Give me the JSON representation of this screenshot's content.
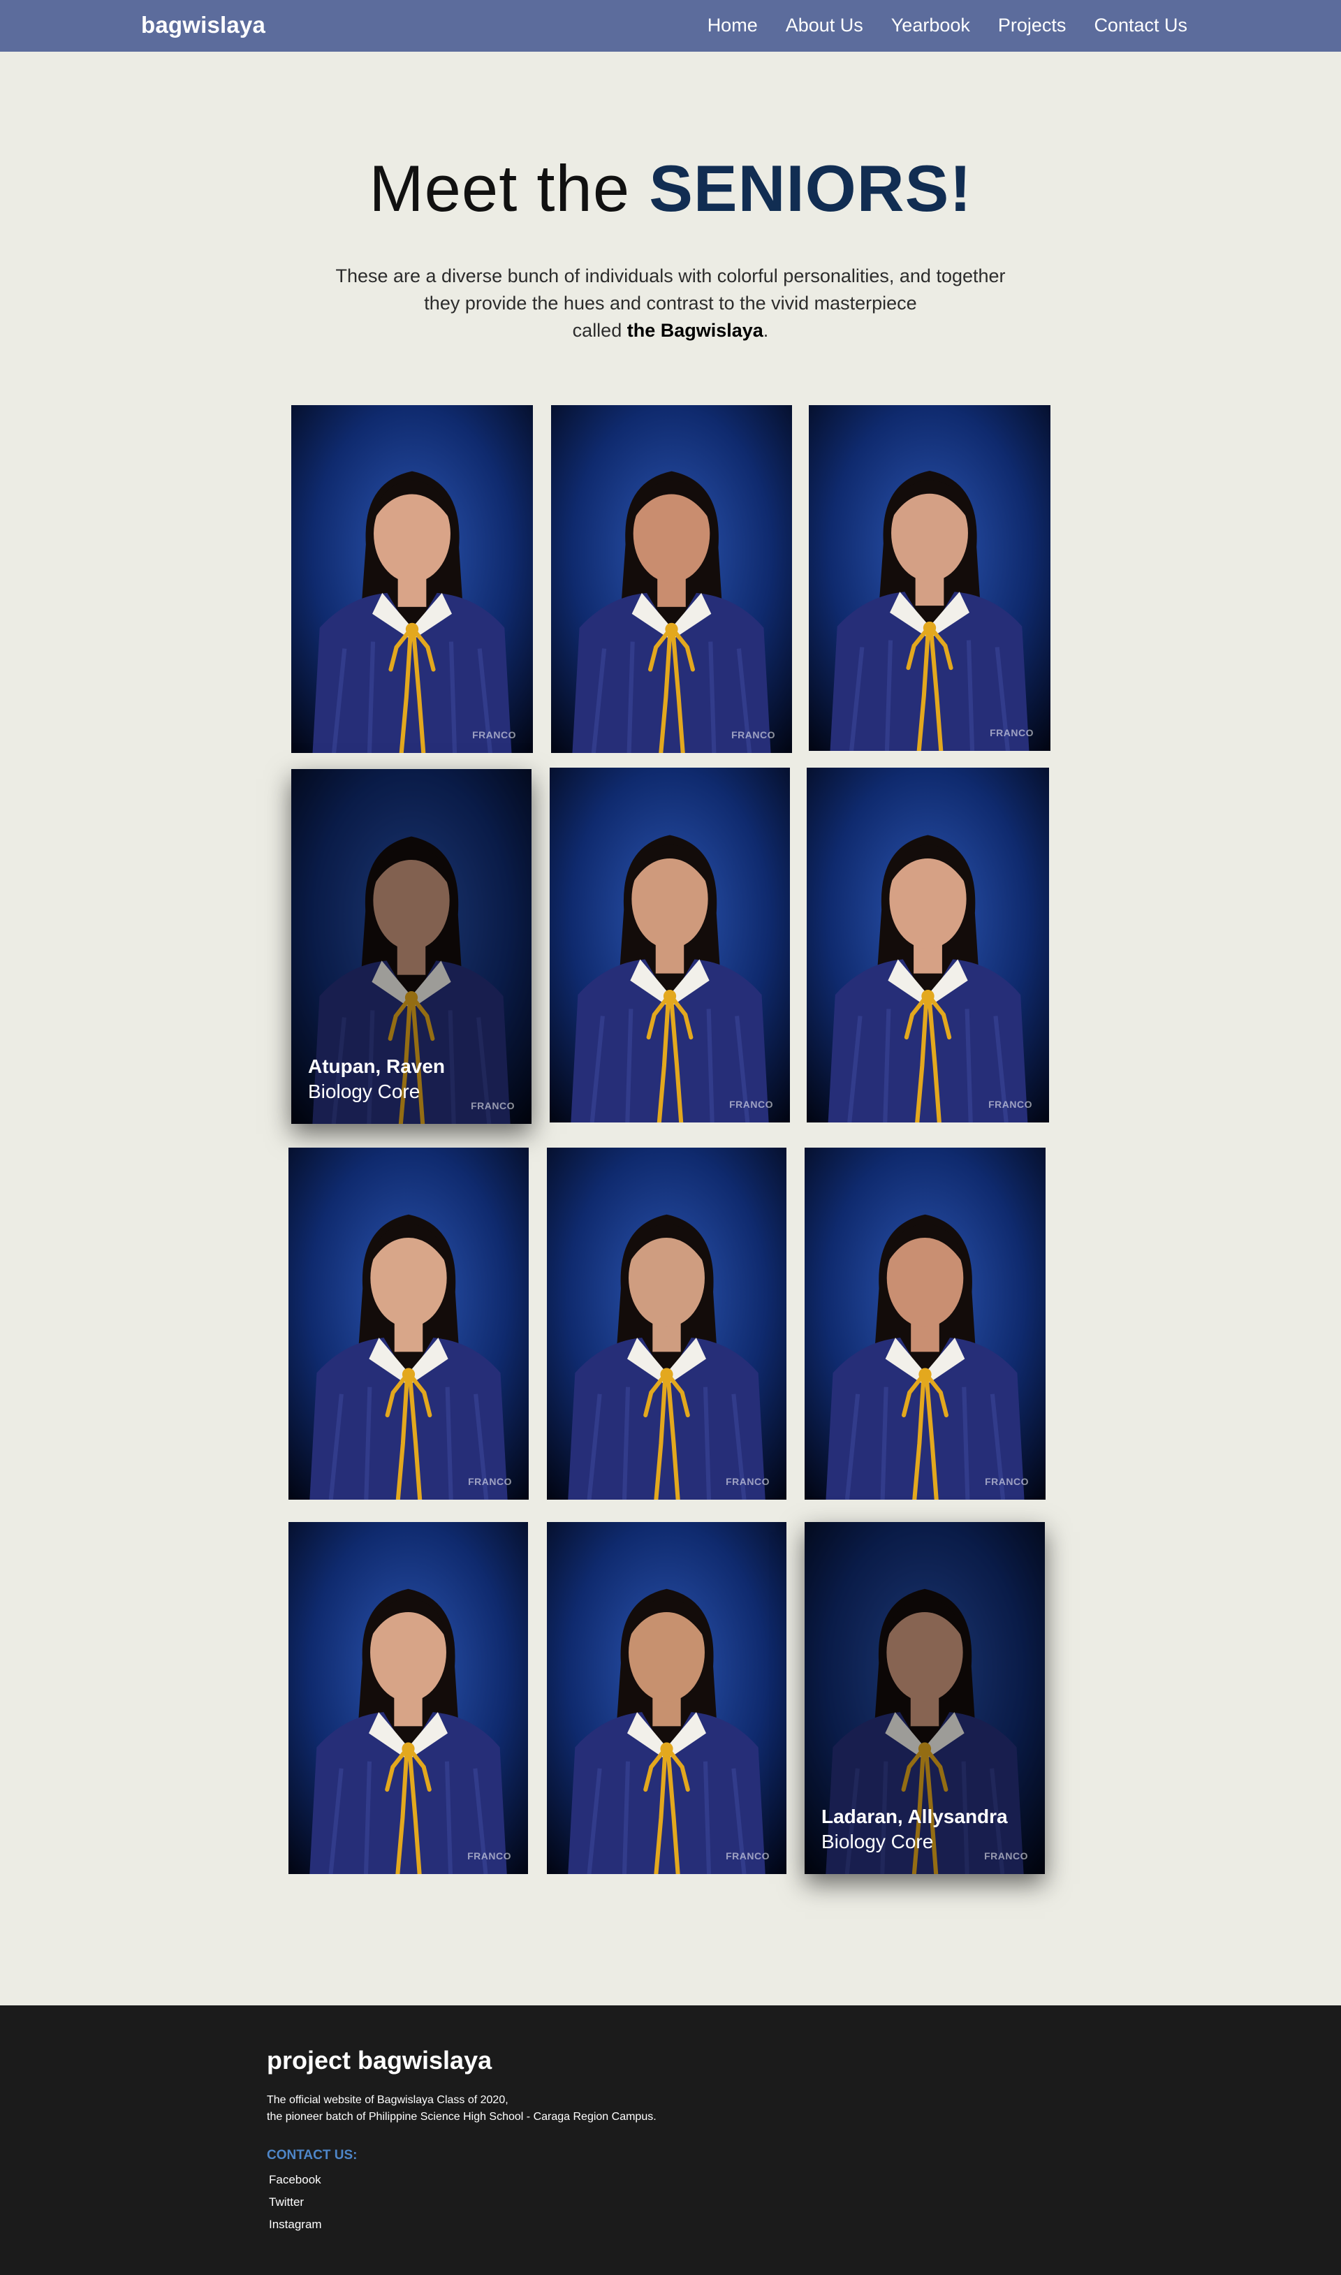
{
  "nav": {
    "brand": "bagwislaya",
    "links": [
      "Home",
      "About Us",
      "Yearbook",
      "Projects",
      "Contact Us"
    ]
  },
  "hero": {
    "title_prefix": "Meet the ",
    "title_accent": "SENIORS!",
    "desc_line1": "These are a diverse bunch of individuals with colorful personalities, and together",
    "desc_line2": "they provide the hues and contrast to the vivid masterpiece",
    "desc_line3_prefix": "called ",
    "desc_line3_bold": "the Bagwislaya",
    "desc_line3_suffix": "."
  },
  "gallery": {
    "watermark": "FRANCO",
    "seniors": [
      {
        "name": "",
        "track": ""
      },
      {
        "name": "",
        "track": ""
      },
      {
        "name": "",
        "track": ""
      },
      {
        "name": "Atupan, Raven",
        "track": "Biology Core"
      },
      {
        "name": "",
        "track": ""
      },
      {
        "name": "",
        "track": ""
      },
      {
        "name": "",
        "track": ""
      },
      {
        "name": "",
        "track": ""
      },
      {
        "name": "",
        "track": ""
      },
      {
        "name": "",
        "track": ""
      },
      {
        "name": "",
        "track": ""
      },
      {
        "name": "Ladaran, Allysandra",
        "track": "Biology Core"
      }
    ]
  },
  "footer": {
    "title": "project bagwislaya",
    "desc_line1": "The official website of Bagwislaya Class of 2020,",
    "desc_line2": "the pioneer batch of Philippine Science High School - Caraga Region Campus.",
    "contact_label": "CONTACT US:",
    "links": [
      "Facebook",
      "Twitter",
      "Instagram"
    ]
  },
  "colors": {
    "navbar": "#5c6c9c",
    "page_bg": "#ecece4",
    "accent": "#112d52",
    "footer_bg": "#1b1b1b",
    "contact_label": "#4e86c8",
    "gown": "#262e78",
    "cord": "#e3a81e"
  }
}
